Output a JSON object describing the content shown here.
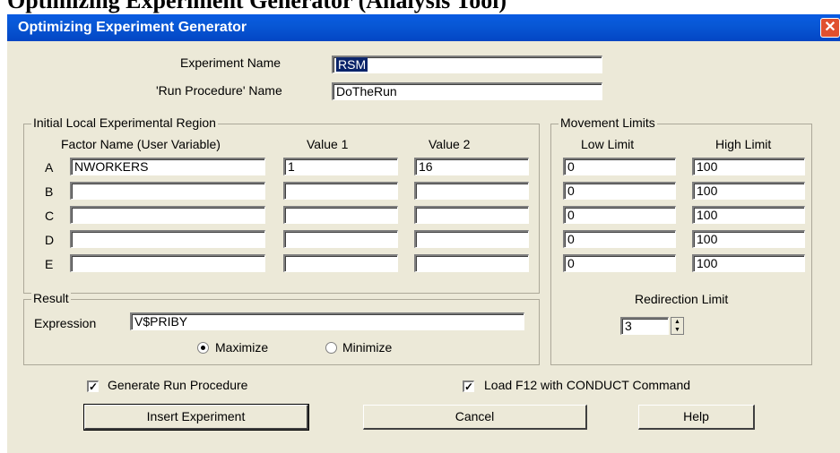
{
  "doc_heading": "Optimizing Experiment Generator (Analysis Tool)",
  "window": {
    "title": "Optimizing Experiment Generator",
    "close": "✕"
  },
  "experiment_name": {
    "label": "Experiment Name",
    "value": "RSM"
  },
  "run_procedure_name": {
    "label": "'Run Procedure' Name",
    "value": "DoTheRun"
  },
  "initial_region": {
    "title": "Initial Local Experimental Region",
    "col_factor": "Factor Name (User Variable)",
    "col_value1": "Value 1",
    "col_value2": "Value 2",
    "rows": [
      {
        "letter": "A",
        "factor": "NWORKERS",
        "v1": "1",
        "v2": "16"
      },
      {
        "letter": "B",
        "factor": "",
        "v1": "",
        "v2": ""
      },
      {
        "letter": "C",
        "factor": "",
        "v1": "",
        "v2": ""
      },
      {
        "letter": "D",
        "factor": "",
        "v1": "",
        "v2": ""
      },
      {
        "letter": "E",
        "factor": "",
        "v1": "",
        "v2": ""
      }
    ]
  },
  "movement_limits": {
    "title": "Movement Limits",
    "col_low": "Low Limit",
    "col_high": "High Limit",
    "rows": [
      {
        "low": "0",
        "high": "100"
      },
      {
        "low": "0",
        "high": "100"
      },
      {
        "low": "0",
        "high": "100"
      },
      {
        "low": "0",
        "high": "100"
      },
      {
        "low": "0",
        "high": "100"
      }
    ],
    "redirection_label": "Redirection Limit",
    "redirection_value": "3"
  },
  "result": {
    "title": "Result",
    "expression_label": "Expression",
    "expression_value": "V$PRIBY",
    "maximize": "Maximize",
    "minimize": "Minimize",
    "selected": "Maximize"
  },
  "checkboxes": {
    "generate_run_procedure": {
      "label": "Generate Run Procedure",
      "checked": true
    },
    "load_f12": {
      "label": "Load F12 with CONDUCT Command",
      "checked": true
    }
  },
  "buttons": {
    "insert": "Insert Experiment",
    "cancel": "Cancel",
    "help": "Help"
  }
}
